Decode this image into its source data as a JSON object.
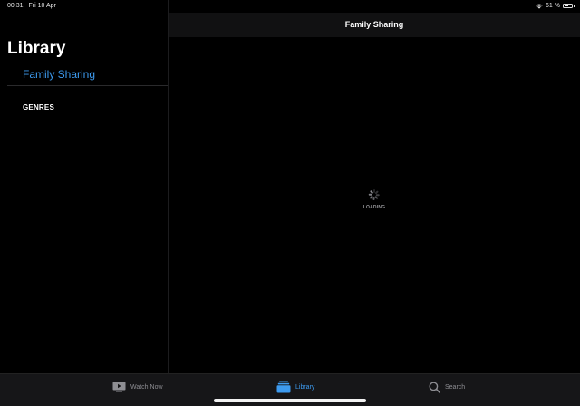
{
  "status_bar": {
    "time": "00:31",
    "date": "Fri 10 Apr",
    "battery_text": "61 %",
    "battery_level": 0.61,
    "wifi_icon": "wifi-icon",
    "battery_icon": "battery-icon"
  },
  "sidebar": {
    "title": "Library",
    "items": [
      {
        "label": "Family Sharing",
        "selected": true
      }
    ],
    "section_header": "GENRES"
  },
  "main": {
    "title": "Family Sharing",
    "loading_text": "LOADING",
    "spinner_icon": "loading-spinner-icon"
  },
  "tab_bar": {
    "tabs": [
      {
        "label": "Watch Now",
        "icon": "tv-play-icon",
        "active": false
      },
      {
        "label": "Library",
        "icon": "library-stack-icon",
        "active": true
      },
      {
        "label": "Search",
        "icon": "search-icon",
        "active": false
      }
    ]
  },
  "colors": {
    "accent": "#3d9bf0",
    "background": "#000000",
    "tab_bar_background": "#161618",
    "inactive": "#8e8e93"
  }
}
